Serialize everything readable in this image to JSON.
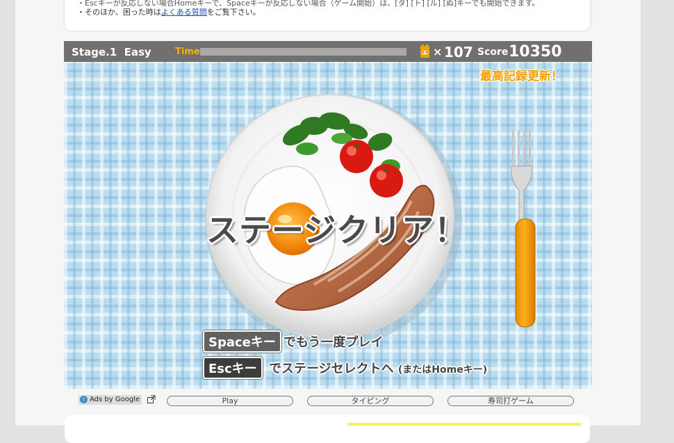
{
  "notice": {
    "line1_partial": "・Escキーが反応しない場合Homeキーで、Spaceキーが反応しない場合（ゲーム開始）は、[タ] [ト] [ル] [ぬ]キーでも開始できます。",
    "line2_prefix": "・そのほか、困った時は",
    "line2_link": "よくある質問",
    "line2_suffix": "をご覧下さい。"
  },
  "hud": {
    "stage": "Stage.1",
    "difficulty": "Easy",
    "time_label": "Time",
    "time_remaining": 0,
    "multiplier_symbol": "×",
    "ticket_count": "107",
    "score_label": "Score",
    "score": "10350"
  },
  "game": {
    "record_text": "最高記録更新！",
    "clear_text": "ステージクリア！",
    "space_key": "Spaceキー",
    "space_text": "でもう一度プレイ",
    "esc_key": "Escキー",
    "esc_text": "でステージセレクトへ",
    "esc_sub": "(またはHomeキー)"
  },
  "bottom": {
    "ads_label": "Ads by Google",
    "buttons": [
      "Play",
      "タイピング",
      "寿司打ゲーム"
    ]
  },
  "colors": {
    "hud_bg": "#707070",
    "time_label": "#ffb000",
    "record": "#f5a000",
    "tablecloth": "#b9dcef"
  }
}
